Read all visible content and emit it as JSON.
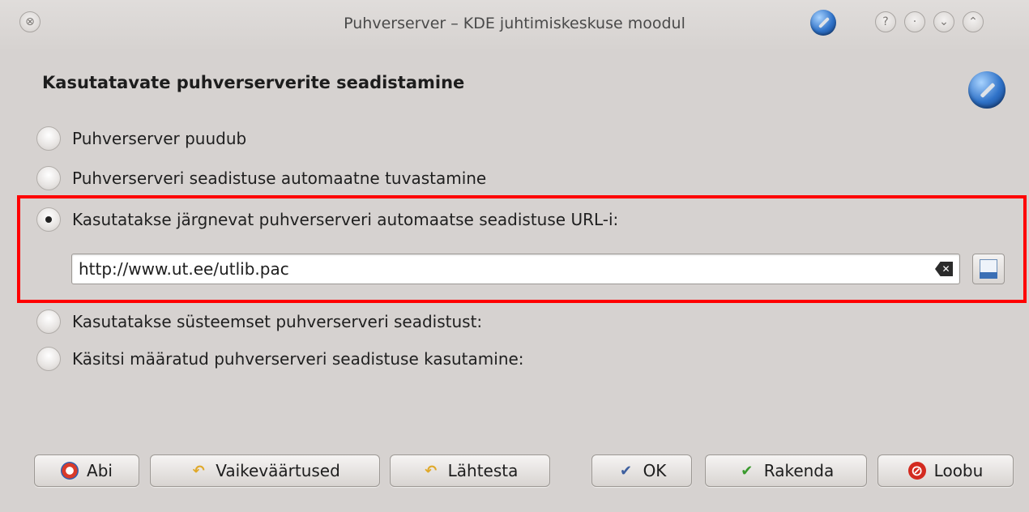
{
  "window": {
    "title": "Puhverserver – KDE juhtimiskeskuse moodul",
    "close_symbol": "⊗",
    "help_symbol": "?",
    "shade_symbol": "·",
    "min_symbol": "⌄",
    "max_symbol": "⌃"
  },
  "heading": "Kasutatavate puhverserverite seadistamine",
  "options": [
    {
      "label": "Puhverserver puudub",
      "selected": false
    },
    {
      "label": "Puhverserveri seadistuse automaatne tuvastamine",
      "selected": false
    },
    {
      "label": "Kasutatakse järgnevat puhverserveri automaatse seadistuse URL-i:",
      "selected": true
    },
    {
      "label": "Kasutatakse süsteemset puhverserveri seadistust:",
      "selected": false
    },
    {
      "label": "Käsitsi määratud puhverserveri seadistuse kasutamine:",
      "selected": false
    }
  ],
  "url_field": {
    "value": "http://www.ut.ee/utlib.pac"
  },
  "buttons": {
    "help": "Abi",
    "defaults": "Vaikeväärtused",
    "reset": "Lähtesta",
    "ok": "OK",
    "apply": "Rakenda",
    "cancel": "Loobu"
  },
  "icons": {
    "ok_glyph": "✔",
    "apply_glyph": "✔",
    "cancel_glyph": "⊘",
    "undo_glyph": "↶",
    "clear_glyph": "✕"
  },
  "colors": {
    "highlight": "#ff0000",
    "background": "#d6d2d0"
  }
}
